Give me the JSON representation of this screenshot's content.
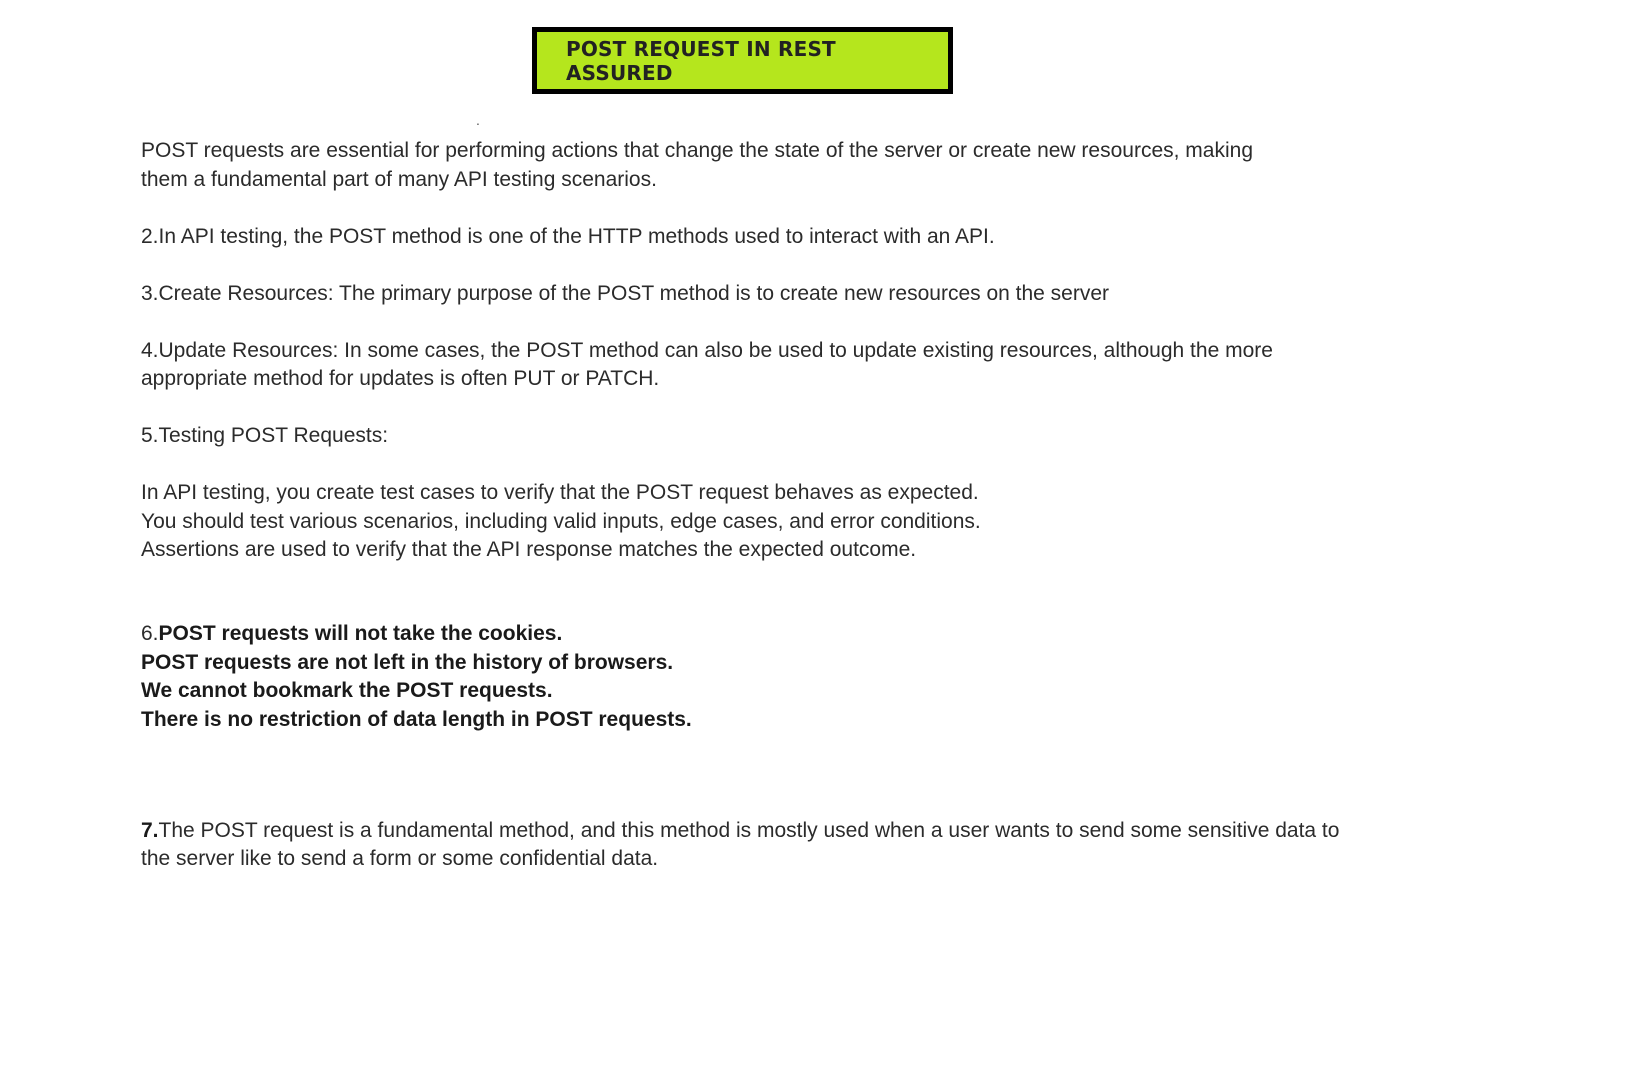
{
  "title": "POST REQUEST IN REST ASSURED",
  "stray_mark": ".",
  "p1": {
    "line1": "POST requests are essential for performing actions that change the state of the server or create new resources, making",
    "line2": "them a fundamental part of many API testing scenarios."
  },
  "p2": "2.In API testing, the POST method is one of the HTTP methods used to interact with an API.",
  "p3": "3.Create Resources: The primary purpose of the POST method is to create new resources on the server",
  "p4": {
    "line1": "4.Update Resources: In some cases, the POST method can also be used to update existing resources, although the more",
    "line2": "appropriate method for updates is often PUT or PATCH."
  },
  "p5": "5.Testing POST Requests:",
  "p6": {
    "line1": "In API testing, you create test cases to verify that the POST request behaves as expected.",
    "line2": "You should test various scenarios, including valid inputs, edge cases, and error conditions.",
    "line3": "Assertions are used to verify that the API response matches the expected outcome."
  },
  "p7": {
    "number": "6.",
    "line1": "POST requests will not take the cookies.",
    "line2": "POST requests are not left in the history of browsers.",
    "line3": "We cannot bookmark the POST requests.",
    "line4": "There is no restriction of data length in POST requests."
  },
  "p8": {
    "number": "7.",
    "line1": "The POST request is a fundamental method, and this method is mostly used when a user wants to send some sensitive data to",
    "line2": "the server like to send a form or some confidential data."
  }
}
